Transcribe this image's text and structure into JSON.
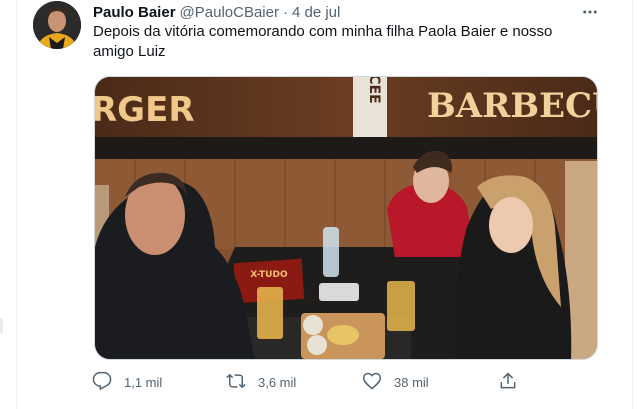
{
  "tweet": {
    "author_name": "Paulo Baier",
    "author_handle": "@PauloCBaier",
    "separator": "·",
    "date": "4 de jul",
    "text": "Depois da vitória comemorando com minha filha Paola Baier e nosso amigo Luiz",
    "more_icon": "more-horizontal-icon"
  },
  "media": {
    "sign_left": "RGER",
    "sign_middle": "CEE",
    "sign_right": "BARBECUE",
    "menu_text": "X-TUDO"
  },
  "actions": {
    "reply_count": "1,1 mil",
    "retweet_count": "3,6 mil",
    "like_count": "38 mil",
    "share_icon": "share-icon"
  },
  "colors": {
    "text_primary": "#0f1419",
    "text_secondary": "#536471",
    "border": "#cfd9de"
  }
}
